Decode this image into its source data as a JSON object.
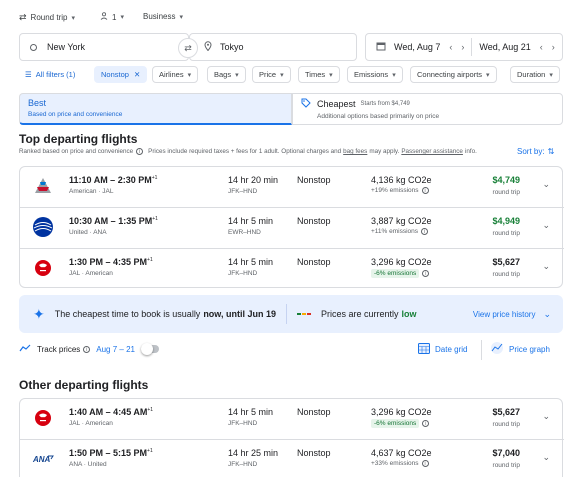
{
  "trip_controls": {
    "trip_type": "Round trip",
    "passengers": "1",
    "cabin": "Business"
  },
  "search": {
    "origin": "New York",
    "destination": "Tokyo",
    "depart_date": "Wed, Aug 7",
    "return_date": "Wed, Aug 21"
  },
  "filters": {
    "all_filters": "All filters (1)",
    "chips": [
      "Nonstop",
      "Airlines",
      "Bags",
      "Price",
      "Times",
      "Emissions",
      "Connecting airports",
      "Duration"
    ]
  },
  "sort_tabs": {
    "best_label": "Best",
    "best_sub": "Based on price and convenience",
    "cheapest_label": "Cheapest",
    "cheapest_from": "Starts from $4,749",
    "cheapest_sub": "Additional options based primarily on price"
  },
  "top_section": {
    "title": "Top departing flights",
    "note_prefix": "Ranked based on price and convenience",
    "note_mid": "Prices include required taxes + fees for 1 adult. Optional charges and",
    "bag_fees": "bag fees",
    "note_mid2": "may apply.",
    "assist": "Passenger assistance",
    "note_end": "info.",
    "sort_by": "Sort by:"
  },
  "top_flights": [
    {
      "time": "11:10 AM – 2:30 PM",
      "plus": "+1",
      "airlines": "American · JAL",
      "duration": "14 hr 20 min",
      "route": "JFK–HND",
      "stops": "Nonstop",
      "co2": "4,136 kg CO2e",
      "emissions": "+19% emissions",
      "price": "$4,749",
      "price_type": "round trip"
    },
    {
      "time": "10:30 AM – 1:35 PM",
      "plus": "+1",
      "airlines": "United · ANA",
      "duration": "14 hr 5 min",
      "route": "EWR–HND",
      "stops": "Nonstop",
      "co2": "3,887 kg CO2e",
      "emissions": "+11% emissions",
      "price": "$4,949",
      "price_type": "round trip"
    },
    {
      "time": "1:30 PM – 4:35 PM",
      "plus": "+1",
      "airlines": "JAL · American",
      "duration": "14 hr 5 min",
      "route": "JFK–HND",
      "stops": "Nonstop",
      "co2": "3,296 kg CO2e",
      "emissions": "-6% emissions",
      "price": "$5,627",
      "price_type": "round trip"
    }
  ],
  "insight": {
    "cheapest_prefix": "The cheapest time to book is usually",
    "cheapest_bold": "now, until Jun 19",
    "prices_prefix": "Prices are currently",
    "prices_status": "low",
    "history_link": "View price history"
  },
  "track": {
    "label": "Track prices",
    "dates": "Aug 7 – 21",
    "date_grid": "Date grid",
    "price_graph": "Price graph"
  },
  "other_section": {
    "title": "Other departing flights"
  },
  "other_flights": [
    {
      "time": "1:40 AM – 4:45 AM",
      "plus": "+1",
      "airlines": "JAL · American",
      "duration": "14 hr 5 min",
      "route": "JFK–HND",
      "stops": "Nonstop",
      "co2": "3,296 kg CO2e",
      "emissions": "-6% emissions",
      "price": "$5,627",
      "price_type": "round trip"
    },
    {
      "time": "1:50 PM – 5:15 PM",
      "plus": "+1",
      "airlines": "ANA · United",
      "duration": "14 hr 25 min",
      "route": "JFK–HND",
      "stops": "Nonstop",
      "co2": "4,637 kg CO2e",
      "emissions": "+33% emissions",
      "price": "$7,040",
      "price_type": "round trip"
    }
  ],
  "colors": {
    "accent": "#1a73e8",
    "green": "#188038",
    "american_red": "#c8102e",
    "united_blue": "#0033a0",
    "jal_red": "#d7000f",
    "ana_blue": "#13448f"
  }
}
